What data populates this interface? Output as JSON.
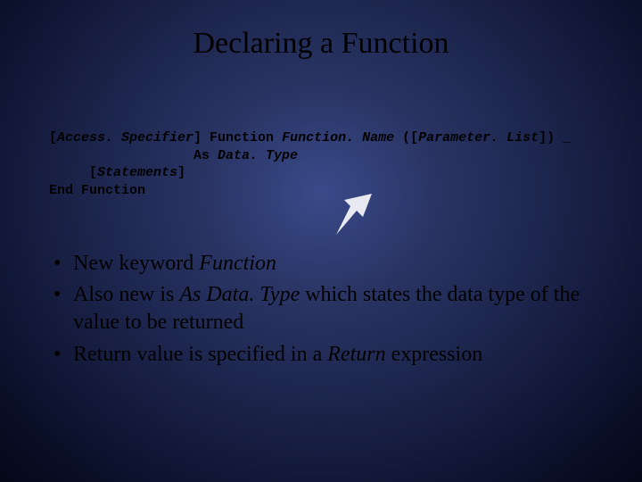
{
  "title": "Declaring a Function",
  "code": {
    "line1_a": "[",
    "line1_b": "Access. Specifier",
    "line1_c": "] Function ",
    "line1_d": "Function. Name",
    "line1_e": " ([",
    "line1_f": "Parameter. List",
    "line1_g": "]) _",
    "line2_a": "                  As ",
    "line2_b": "Data. Type",
    "line3_a": "     [",
    "line3_b": "Statements",
    "line3_c": "]",
    "line4": "End Function"
  },
  "bullets": {
    "b1_a": "New keyword ",
    "b1_b": "Function",
    "b2_a": "Also new is ",
    "b2_b": "As Data. Type",
    "b2_c": " which states the data type of the value to be returned",
    "b3_a": "Return value is specified in a ",
    "b3_b": "Return",
    "b3_c": " expression"
  }
}
